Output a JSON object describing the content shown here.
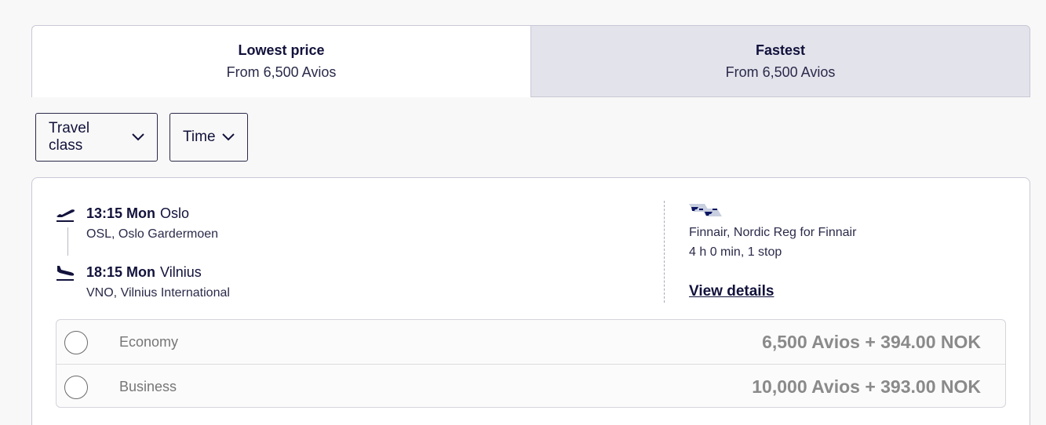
{
  "tabs": [
    {
      "title": "Lowest price",
      "subtitle": "From 6,500 Avios"
    },
    {
      "title": "Fastest",
      "subtitle": "From 6,500 Avios"
    }
  ],
  "filters": {
    "travel_class": "Travel class",
    "time": "Time"
  },
  "flight": {
    "departure": {
      "time": "13:15 Mon",
      "city": "Oslo",
      "airport": "OSL, Oslo Gardermoen",
      "icon": "takeoff-icon"
    },
    "arrival": {
      "time": "18:15 Mon",
      "city": "Vilnius",
      "airport": "VNO, Vilnius International",
      "icon": "landing-icon"
    },
    "airline": "Finnair, Nordic Reg for Finnair",
    "duration": "4 h 0 min, 1 stop",
    "view_details": "View details",
    "airline_logo": "finnair-logo"
  },
  "fares": [
    {
      "class": "Economy",
      "price": "6,500 Avios + 394.00 NOK",
      "selected": false
    },
    {
      "class": "Business",
      "price": "10,000 Avios + 393.00 NOK",
      "selected": false
    }
  ],
  "colors": {
    "primary_text": "#12123c",
    "tab_inactive_bg": "#e3e3ec",
    "page_bg": "#f8f8f8",
    "muted_price": "#8a8a8a"
  }
}
